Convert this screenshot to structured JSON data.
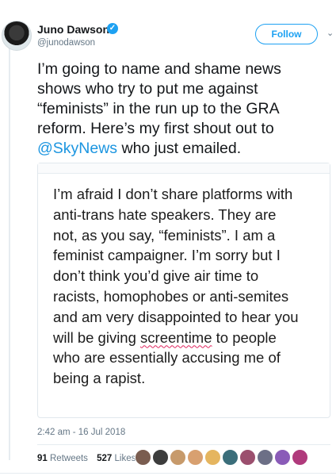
{
  "author": {
    "name": "Juno Dawson",
    "handle": "@junodawson",
    "verified_icon": "verified-badge-icon",
    "follow_label": "Follow"
  },
  "tweet": {
    "lines": [
      "I’m going to name and shame news",
      "shows who try to put me against",
      "“feminists” in the run up to the GRA",
      "reform. Here’s my first shout out to"
    ],
    "mention": "@SkyNews",
    "mention_tail": " who just emailed."
  },
  "quote": {
    "lines": [
      "I’m afraid I don’t share platforms with",
      "anti-trans hate speakers. They are",
      "not, as you say, “feminists”. I am a",
      "feminist campaigner. I’m sorry but I",
      "don’t think you’d give air time to",
      "racists, homophobes or anti-semites",
      "and am very disappointed to hear you"
    ],
    "line8_pre": "will be giving ",
    "line8_flagged": "screentime",
    "line8_post": " to people",
    "line9": "who are essentially accusing me of",
    "line10": "being a rapist."
  },
  "timestamp": "2:42 am - 16 Jul 2018",
  "stats": {
    "retweets_count": "91",
    "retweets_label": "Retweets",
    "likes_count": "527",
    "likes_label": "Likes"
  },
  "likers_colors": [
    "#7a5d50",
    "#3d3d3d",
    "#c79a6b",
    "#d8a070",
    "#e5b55f",
    "#3b6e7a",
    "#9b4f6e",
    "#6c6f86",
    "#8a5bb8",
    "#b03a7c"
  ],
  "colors": {
    "accent": "#1da1f2",
    "mention": "#1b95e0",
    "muted": "#657786"
  }
}
